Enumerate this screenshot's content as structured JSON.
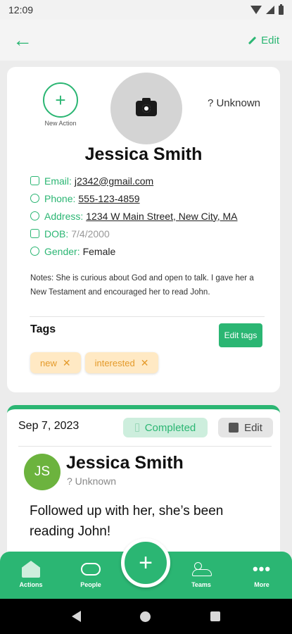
{
  "status": {
    "time": "12:09"
  },
  "appbar": {
    "back_icon": "arrow-left-icon",
    "edit_label": "Edit"
  },
  "person": {
    "new_action_label": "New Action",
    "photo_icon": "camera-icon",
    "status_label": "? Unknown",
    "name": "Jessica Smith",
    "fields": [
      {
        "icon": "mail-icon",
        "label": "Email:",
        "value": "j2342@gmail.com"
      },
      {
        "icon": "phone-icon",
        "label": "Phone:",
        "value": "555-123-4859"
      },
      {
        "icon": "location-pin-icon",
        "label": "Address:",
        "value": "1234 W Main Street, New City, MA"
      },
      {
        "icon": "calendar-icon",
        "label": "DOB:",
        "value": "7/4/2000"
      },
      {
        "icon": "gender-icon",
        "label": "Gender:",
        "value": "Female"
      }
    ],
    "notes": "Notes: She is curious about God and open to talk. I gave her a New Testament and encouraged her to read John.",
    "tags_title": "Tags",
    "edit_tags_label": "Edit tags",
    "tags": [
      {
        "label": "new"
      },
      {
        "label": "interested"
      }
    ]
  },
  "action_card": {
    "date": "Sep 7, 2023",
    "completed_label": "Completed",
    "edit_label": "Edit",
    "avatar_initials": "JS",
    "name": "Jessica Smith",
    "status": "? Unknown",
    "note": "Followed up with her, she’s been reading John!"
  },
  "bottom_nav": {
    "items": [
      {
        "label": "Actions",
        "icon": "home-icon"
      },
      {
        "label": "People",
        "icon": "handshake-icon"
      },
      {
        "label": "Teams",
        "icon": "people-icon"
      },
      {
        "label": "More",
        "icon": "more-dots-icon"
      }
    ],
    "fab_icon": "plus-icon"
  },
  "colors": {
    "accent": "#2bb673",
    "tag_bg": "#ffe9c4",
    "tag_text": "#e49a2a"
  }
}
